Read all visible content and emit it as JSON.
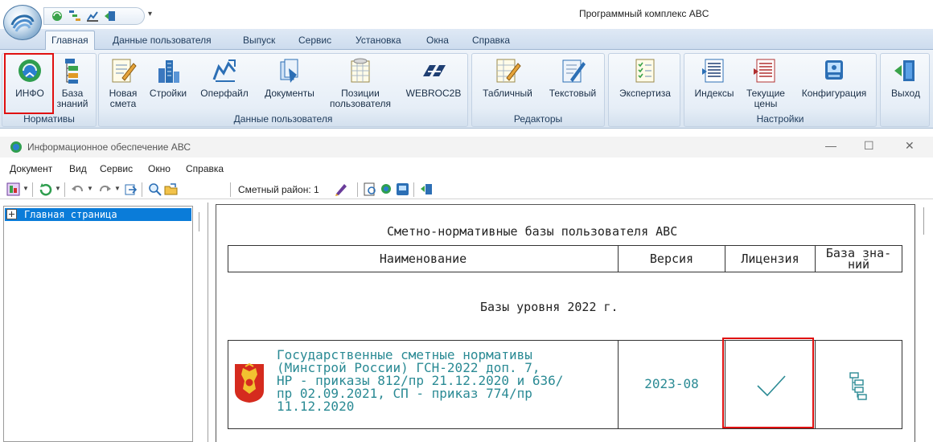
{
  "app": {
    "title": "Программный комплекс ABC"
  },
  "ribbon": {
    "tabs": [
      {
        "label": "Главная",
        "active": true
      },
      {
        "label": "Данные пользователя"
      },
      {
        "label": "Выпуск"
      },
      {
        "label": "Сервис"
      },
      {
        "label": "Установка"
      },
      {
        "label": "Окна"
      },
      {
        "label": "Справка"
      }
    ],
    "groups": {
      "normatives": {
        "label": "Нормативы",
        "buttons": [
          {
            "line1": "ИНФО",
            "line2": "",
            "icon": "info-globe-icon"
          },
          {
            "line1": "База",
            "line2": "знаний",
            "icon": "knowledge-base-icon"
          }
        ]
      },
      "user_data": {
        "label": "Данные пользователя",
        "buttons": [
          {
            "line1": "Новая",
            "line2": "смета",
            "icon": "new-estimate-icon"
          },
          {
            "line1": "Стройки",
            "line2": "",
            "icon": "buildings-icon"
          },
          {
            "line1": "Оперфайл",
            "line2": "",
            "icon": "operfile-icon"
          },
          {
            "line1": "Документы",
            "line2": "",
            "icon": "documents-icon"
          },
          {
            "line1": "Позиции",
            "line2": "пользователя",
            "icon": "user-positions-icon"
          },
          {
            "line1": "WEBROC2B",
            "line2": "",
            "icon": "webroc-icon"
          }
        ]
      },
      "editors": {
        "label": "Редакторы",
        "buttons": [
          {
            "line1": "Табличный",
            "line2": "",
            "icon": "table-editor-icon"
          },
          {
            "line1": "Текстовый",
            "line2": "",
            "icon": "text-editor-icon"
          }
        ]
      },
      "expertise": {
        "label": "",
        "buttons": [
          {
            "line1": "Экспертиза",
            "line2": "",
            "icon": "checklist-icon"
          }
        ]
      },
      "settings": {
        "label": "Настройки",
        "buttons": [
          {
            "line1": "Индексы",
            "line2": "",
            "icon": "indexes-icon"
          },
          {
            "line1": "Текущие",
            "line2": "цены",
            "icon": "current-prices-icon"
          },
          {
            "line1": "Конфигурация",
            "line2": "",
            "icon": "configuration-icon"
          }
        ]
      },
      "exit": {
        "label": "",
        "buttons": [
          {
            "line1": "Выход",
            "line2": "",
            "icon": "exit-door-icon"
          }
        ]
      }
    }
  },
  "inner_window": {
    "title": "Информационное обеспечение АВС",
    "controls": {
      "minimize": "—",
      "maximize": "☐",
      "close": "✕"
    },
    "menu": [
      "Документ",
      "Вид",
      "Сервис",
      "Окно",
      "Справка"
    ],
    "toolbar": {
      "region_label": "Сметный район: 1"
    }
  },
  "tree": {
    "items": [
      {
        "label": "Главная страница",
        "selected": true
      }
    ]
  },
  "content": {
    "title": "Сметно-нормативные базы пользователя АВС",
    "headers": {
      "name": "Наименование",
      "version": "Версия",
      "license": "Лицензия",
      "kb_line1": "База зна-",
      "kb_line2": "ний"
    },
    "section_title": "Базы уровня 2022 г.",
    "rows": [
      {
        "name": "Государственные сметные нормативы\n(Минстрой России) ГСН-2022 доп. 7,\nНР - приказы 812/пр 21.12.2020 и 636/\nпр 02.09.2021, СП - приказ 774/пр\n11.12.2020",
        "version": "2023-08",
        "license_icon": "checkmark-icon",
        "kb_icon": "knowledge-tree-icon"
      }
    ]
  },
  "colors": {
    "ribbon_text": "#1e3b5c",
    "link_teal": "#2a8a94",
    "selection_blue": "#0a7cd9",
    "highlight_red": "#e01010"
  }
}
